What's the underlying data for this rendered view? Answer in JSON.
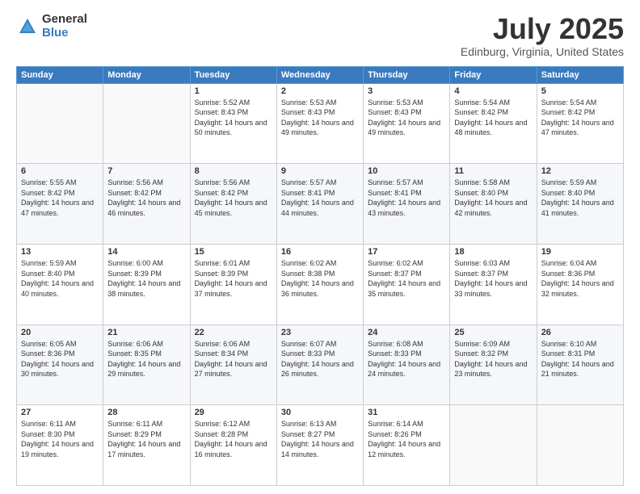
{
  "logo": {
    "general": "General",
    "blue": "Blue"
  },
  "title": "July 2025",
  "location": "Edinburg, Virginia, United States",
  "days_of_week": [
    "Sunday",
    "Monday",
    "Tuesday",
    "Wednesday",
    "Thursday",
    "Friday",
    "Saturday"
  ],
  "weeks": [
    [
      {
        "day": "",
        "content": ""
      },
      {
        "day": "",
        "content": ""
      },
      {
        "day": "1",
        "content": "Sunrise: 5:52 AM\nSunset: 8:43 PM\nDaylight: 14 hours and 50 minutes."
      },
      {
        "day": "2",
        "content": "Sunrise: 5:53 AM\nSunset: 8:43 PM\nDaylight: 14 hours and 49 minutes."
      },
      {
        "day": "3",
        "content": "Sunrise: 5:53 AM\nSunset: 8:43 PM\nDaylight: 14 hours and 49 minutes."
      },
      {
        "day": "4",
        "content": "Sunrise: 5:54 AM\nSunset: 8:42 PM\nDaylight: 14 hours and 48 minutes."
      },
      {
        "day": "5",
        "content": "Sunrise: 5:54 AM\nSunset: 8:42 PM\nDaylight: 14 hours and 47 minutes."
      }
    ],
    [
      {
        "day": "6",
        "content": "Sunrise: 5:55 AM\nSunset: 8:42 PM\nDaylight: 14 hours and 47 minutes."
      },
      {
        "day": "7",
        "content": "Sunrise: 5:56 AM\nSunset: 8:42 PM\nDaylight: 14 hours and 46 minutes."
      },
      {
        "day": "8",
        "content": "Sunrise: 5:56 AM\nSunset: 8:42 PM\nDaylight: 14 hours and 45 minutes."
      },
      {
        "day": "9",
        "content": "Sunrise: 5:57 AM\nSunset: 8:41 PM\nDaylight: 14 hours and 44 minutes."
      },
      {
        "day": "10",
        "content": "Sunrise: 5:57 AM\nSunset: 8:41 PM\nDaylight: 14 hours and 43 minutes."
      },
      {
        "day": "11",
        "content": "Sunrise: 5:58 AM\nSunset: 8:40 PM\nDaylight: 14 hours and 42 minutes."
      },
      {
        "day": "12",
        "content": "Sunrise: 5:59 AM\nSunset: 8:40 PM\nDaylight: 14 hours and 41 minutes."
      }
    ],
    [
      {
        "day": "13",
        "content": "Sunrise: 5:59 AM\nSunset: 8:40 PM\nDaylight: 14 hours and 40 minutes."
      },
      {
        "day": "14",
        "content": "Sunrise: 6:00 AM\nSunset: 8:39 PM\nDaylight: 14 hours and 38 minutes."
      },
      {
        "day": "15",
        "content": "Sunrise: 6:01 AM\nSunset: 8:39 PM\nDaylight: 14 hours and 37 minutes."
      },
      {
        "day": "16",
        "content": "Sunrise: 6:02 AM\nSunset: 8:38 PM\nDaylight: 14 hours and 36 minutes."
      },
      {
        "day": "17",
        "content": "Sunrise: 6:02 AM\nSunset: 8:37 PM\nDaylight: 14 hours and 35 minutes."
      },
      {
        "day": "18",
        "content": "Sunrise: 6:03 AM\nSunset: 8:37 PM\nDaylight: 14 hours and 33 minutes."
      },
      {
        "day": "19",
        "content": "Sunrise: 6:04 AM\nSunset: 8:36 PM\nDaylight: 14 hours and 32 minutes."
      }
    ],
    [
      {
        "day": "20",
        "content": "Sunrise: 6:05 AM\nSunset: 8:36 PM\nDaylight: 14 hours and 30 minutes."
      },
      {
        "day": "21",
        "content": "Sunrise: 6:06 AM\nSunset: 8:35 PM\nDaylight: 14 hours and 29 minutes."
      },
      {
        "day": "22",
        "content": "Sunrise: 6:06 AM\nSunset: 8:34 PM\nDaylight: 14 hours and 27 minutes."
      },
      {
        "day": "23",
        "content": "Sunrise: 6:07 AM\nSunset: 8:33 PM\nDaylight: 14 hours and 26 minutes."
      },
      {
        "day": "24",
        "content": "Sunrise: 6:08 AM\nSunset: 8:33 PM\nDaylight: 14 hours and 24 minutes."
      },
      {
        "day": "25",
        "content": "Sunrise: 6:09 AM\nSunset: 8:32 PM\nDaylight: 14 hours and 23 minutes."
      },
      {
        "day": "26",
        "content": "Sunrise: 6:10 AM\nSunset: 8:31 PM\nDaylight: 14 hours and 21 minutes."
      }
    ],
    [
      {
        "day": "27",
        "content": "Sunrise: 6:11 AM\nSunset: 8:30 PM\nDaylight: 14 hours and 19 minutes."
      },
      {
        "day": "28",
        "content": "Sunrise: 6:11 AM\nSunset: 8:29 PM\nDaylight: 14 hours and 17 minutes."
      },
      {
        "day": "29",
        "content": "Sunrise: 6:12 AM\nSunset: 8:28 PM\nDaylight: 14 hours and 16 minutes."
      },
      {
        "day": "30",
        "content": "Sunrise: 6:13 AM\nSunset: 8:27 PM\nDaylight: 14 hours and 14 minutes."
      },
      {
        "day": "31",
        "content": "Sunrise: 6:14 AM\nSunset: 8:26 PM\nDaylight: 14 hours and 12 minutes."
      },
      {
        "day": "",
        "content": ""
      },
      {
        "day": "",
        "content": ""
      }
    ]
  ]
}
